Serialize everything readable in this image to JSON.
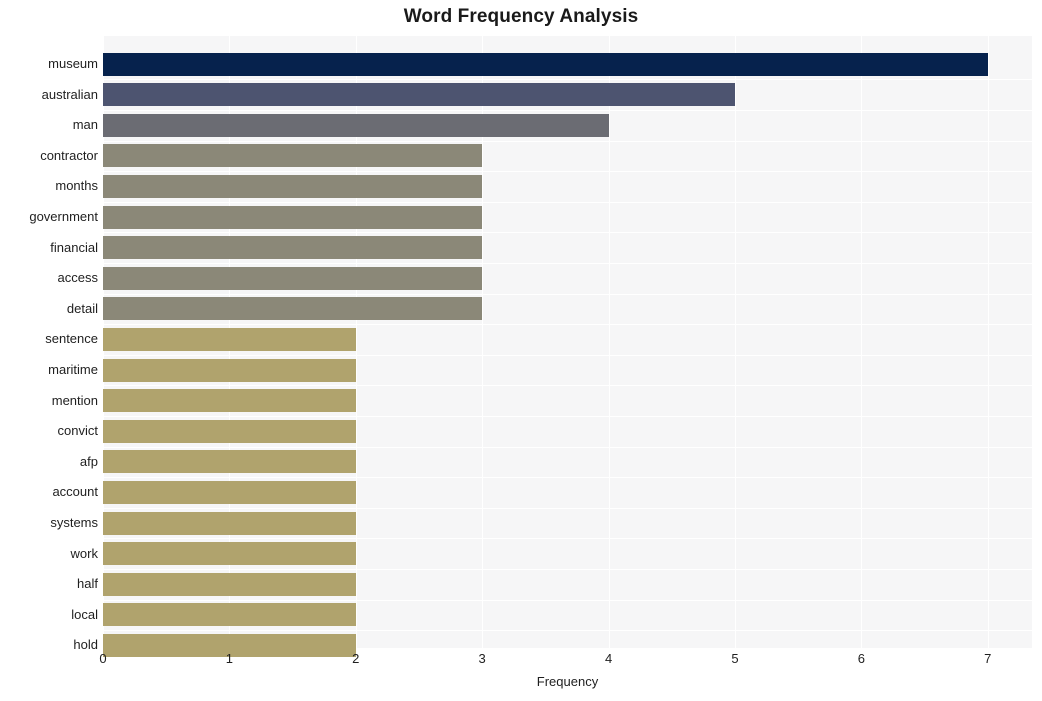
{
  "chart_data": {
    "type": "bar",
    "orientation": "horizontal",
    "title": "Word Frequency Analysis",
    "xlabel": "Frequency",
    "ylabel": "",
    "xlim": [
      0,
      7.35
    ],
    "xticks": [
      0,
      1,
      2,
      3,
      4,
      5,
      6,
      7
    ],
    "xtick_labels": [
      "0",
      "1",
      "2",
      "3",
      "4",
      "5",
      "6",
      "7"
    ],
    "grid": true,
    "legend": null,
    "categories": [
      "museum",
      "australian",
      "man",
      "contractor",
      "months",
      "government",
      "financial",
      "access",
      "detail",
      "sentence",
      "maritime",
      "mention",
      "convict",
      "afp",
      "account",
      "systems",
      "work",
      "half",
      "local",
      "hold"
    ],
    "values": [
      7,
      5,
      4,
      3,
      3,
      3,
      3,
      3,
      3,
      2,
      2,
      2,
      2,
      2,
      2,
      2,
      2,
      2,
      2,
      2
    ],
    "bar_colors": [
      "#06224d",
      "#4d5470",
      "#6b6c73",
      "#8b8878",
      "#8b8878",
      "#8b8878",
      "#8b8878",
      "#8b8878",
      "#8b8878",
      "#b0a36d",
      "#b0a36d",
      "#b0a36d",
      "#b0a36d",
      "#b0a36d",
      "#b0a36d",
      "#b0a36d",
      "#b0a36d",
      "#b0a36d",
      "#b0a36d",
      "#b0a36d"
    ]
  },
  "style": {
    "plot_background": "#f6f6f7",
    "figure_background": "#ffffff",
    "gridline_color": "#ffffff",
    "text_color": "#1f1f1f",
    "title_color": "#1a1a1a"
  }
}
